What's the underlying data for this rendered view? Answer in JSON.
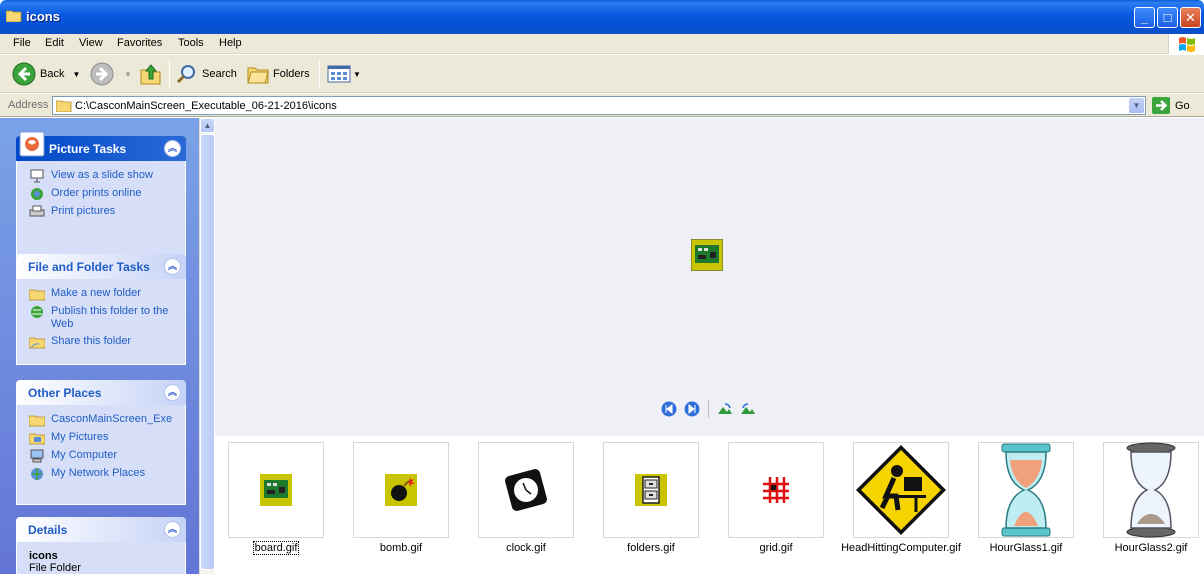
{
  "window": {
    "title": "icons"
  },
  "menu": [
    "File",
    "Edit",
    "View",
    "Favorites",
    "Tools",
    "Help"
  ],
  "toolbar": {
    "back": "Back",
    "search": "Search",
    "folders": "Folders"
  },
  "address": {
    "label": "Address",
    "path": "C:\\CasconMainScreen_Executable_06-21-2016\\icons",
    "go": "Go"
  },
  "panels": {
    "picture_tasks": {
      "title": "Picture Tasks",
      "items": [
        "View as a slide show",
        "Order prints online",
        "Print pictures"
      ]
    },
    "file_folder_tasks": {
      "title": "File and Folder Tasks",
      "items": [
        "Make a new folder",
        "Publish this folder to the Web",
        "Share this folder"
      ]
    },
    "other_places": {
      "title": "Other Places",
      "items": [
        "CasconMainScreen_Exe",
        "My Pictures",
        "My Computer",
        "My Network Places"
      ]
    },
    "details": {
      "title": "Details",
      "name": "icons",
      "type": "File Folder"
    }
  },
  "files": [
    "board.gif",
    "bomb.gif",
    "clock.gif",
    "folders.gif",
    "grid.gif",
    "HeadHittingComputer.gif",
    "HourGlass1.gif",
    "HourGlass2.gif"
  ],
  "colors": {
    "titlebar": "#0453d6",
    "taskpane": "#6f8fe0",
    "link": "#215dc6",
    "preview_bg": "#eef0f5"
  }
}
